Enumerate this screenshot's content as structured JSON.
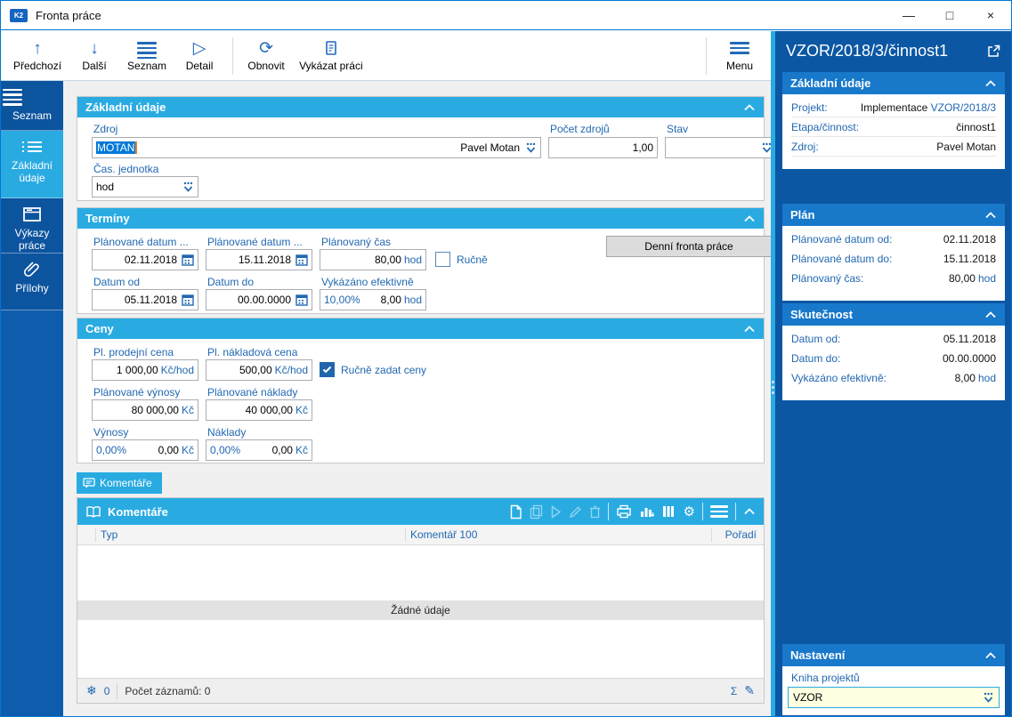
{
  "window": {
    "title": "Fronta práce",
    "controls": {
      "minimize": "—",
      "maximize": "□",
      "close": "×"
    }
  },
  "toolbar": {
    "items": [
      {
        "label": "Předchozí",
        "icon": "arrow-up"
      },
      {
        "label": "Další",
        "icon": "arrow-down"
      },
      {
        "label": "Seznam",
        "icon": "hamburger"
      },
      {
        "label": "Detail",
        "icon": "play-outline"
      },
      {
        "label": "Obnovit",
        "icon": "refresh"
      },
      {
        "label": "Vykázat práci",
        "icon": "report-document"
      }
    ],
    "menu_label": "Menu"
  },
  "sidebar": {
    "items": [
      {
        "label": "Seznam",
        "icon": "hamburger"
      },
      {
        "label": "Základní údaje",
        "icon": "detail-list"
      },
      {
        "label": "Výkazy práce",
        "icon": "archive-box"
      },
      {
        "label": "Přílohy",
        "icon": "paperclip"
      }
    ]
  },
  "zakladni": {
    "title": "Základní údaje",
    "zdroj_label": "Zdroj",
    "zdroj_value": "MOTAN",
    "zdroj_display": "Pavel Motan",
    "pocet_label": "Počet zdrojů",
    "pocet_value": "1,00",
    "stav_label": "Stav",
    "cas_label": "Čas. jednotka",
    "cas_value": "hod"
  },
  "terminy": {
    "title": "Termíny",
    "plan_od_label": "Plánované datum ...",
    "plan_od_value": "02.11.2018",
    "plan_do_label": "Plánované datum ...",
    "plan_do_value": "15.11.2018",
    "plan_cas_label": "Plánovaný čas",
    "plan_cas_value": "80,00",
    "plan_cas_unit": "hod",
    "rucne_label": "Ručně",
    "denni_button": "Denní fronta práce",
    "datum_od_label": "Datum od",
    "datum_od_value": "05.11.2018",
    "datum_do_label": "Datum do",
    "datum_do_value": "00.00.0000",
    "vykazano_label": "Vykázáno efektivně",
    "vykazano_pct": "10,00%",
    "vykazano_value": "8,00",
    "vykazano_unit": "hod"
  },
  "ceny": {
    "title": "Ceny",
    "pl_prodejni_label": "Pl. prodejní cena",
    "pl_prodejni_value": "1 000,00",
    "pl_prodejni_unit": "Kč/hod",
    "pl_nakladova_label": "Pl. nákladová cena",
    "pl_nakladova_value": "500,00",
    "pl_nakladova_unit": "Kč/hod",
    "rucne_ceny_label": "Ručně zadat ceny",
    "plan_vynosy_label": "Plánované výnosy",
    "plan_vynosy_value": "80 000,00",
    "plan_vynosy_unit": "Kč",
    "plan_naklady_label": "Plánované náklady",
    "plan_naklady_value": "40 000,00",
    "plan_naklady_unit": "Kč",
    "vynosy_label": "Výnosy",
    "vynosy_pct": "0,00%",
    "vynosy_value": "0,00",
    "vynosy_unit": "Kč",
    "naklady_label": "Náklady",
    "naklady_pct": "0,00%",
    "naklady_value": "0,00",
    "naklady_unit": "Kč"
  },
  "comments": {
    "tab_label": "Komentáře",
    "grid_title": "Komentáře",
    "columns": [
      "Typ",
      "Komentář 100",
      "Pořadí"
    ],
    "empty_text": "Žádné údaje",
    "footer": {
      "flake_count": "0",
      "records_text": "Počet záznamů: 0"
    }
  },
  "right_panel": {
    "title": "VZOR/2018/3/činnost1",
    "cards": [
      {
        "title": "Základní údaje",
        "rows": [
          {
            "label": "Projekt:",
            "value": "Implementace ",
            "link": "VZOR/2018/3"
          },
          {
            "label": "Etapa/činnost:",
            "value": "činnost1"
          },
          {
            "label": "Zdroj:",
            "value": "Pavel Motan"
          }
        ]
      },
      {
        "title": "Plán",
        "rows": [
          {
            "label": "Plánované datum od:",
            "value": "02.11.2018"
          },
          {
            "label": "Plánované datum do:",
            "value": "15.11.2018"
          },
          {
            "label": "Plánovaný čas:",
            "value": "80,00",
            "unit": "hod"
          }
        ]
      },
      {
        "title": "Skutečnost",
        "rows": [
          {
            "label": "Datum od:",
            "value": "05.11.2018"
          },
          {
            "label": "Datum do:",
            "value": "00.00.0000"
          },
          {
            "label": "Vykázáno efektivně:",
            "value": "8,00",
            "unit": "hod"
          }
        ]
      }
    ],
    "settings": {
      "title": "Nastavení",
      "kniha_label": "Kniha projektů",
      "kniha_value": "VZOR"
    }
  },
  "colors": {
    "accent_cyan": "#29abe2",
    "panel_blue": "#0b57a4",
    "card_header_blue": "#1878ca",
    "label_blue": "#2268b2",
    "selection_blue": "#0078d7",
    "window_border": "#0077d4",
    "field_yellow": "#ffffe1"
  }
}
